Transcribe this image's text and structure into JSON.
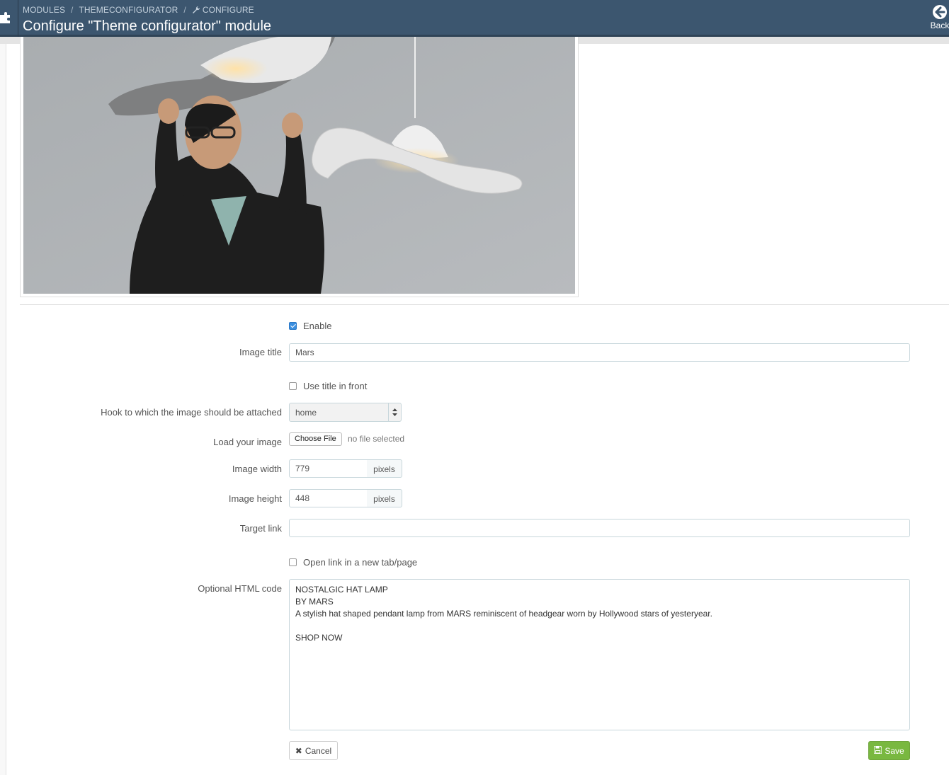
{
  "header": {
    "breadcrumb": [
      "MODULES",
      "THEMECONFIGURATOR",
      "CONFIGURE"
    ],
    "title": "Configure \"Theme configurator\" module",
    "back_label": "Back"
  },
  "form": {
    "enable": {
      "label": "Enable",
      "checked": true
    },
    "image_title": {
      "label": "Image title",
      "value": "Mars"
    },
    "use_title_front": {
      "label": "Use title in front",
      "checked": false
    },
    "hook": {
      "label": "Hook to which the image should be attached",
      "value": "home"
    },
    "load_image": {
      "label": "Load your image",
      "button": "Choose File",
      "status": "no file selected"
    },
    "image_width": {
      "label": "Image width",
      "value": "779",
      "unit": "pixels"
    },
    "image_height": {
      "label": "Image height",
      "value": "448",
      "unit": "pixels"
    },
    "target_link": {
      "label": "Target link",
      "value": ""
    },
    "new_tab": {
      "label": "Open link in a new tab/page",
      "checked": false
    },
    "html_code": {
      "label": "Optional HTML code",
      "lines": [
        "NOSTALGIC HAT LAMP",
        "BY MARS",
        "A stylish hat shaped pendant lamp from MARS reminiscent of headgear worn by Hollywood stars of yesteryear.",
        "",
        "SHOP NOW"
      ]
    }
  },
  "actions": {
    "cancel": "Cancel",
    "save": "Save"
  },
  "colors": {
    "header": "#3c566f",
    "save": "#79b840",
    "checkbox": "#3b8fe0"
  }
}
